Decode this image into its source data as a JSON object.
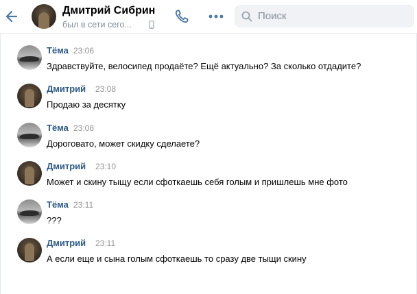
{
  "header": {
    "contact_name": "Дмитрий Сибрин",
    "status": "был в сети сего...",
    "search": {
      "placeholder": "Поиск",
      "value": ""
    }
  },
  "icons": {
    "back": "arrow-left-icon",
    "device": "mobile-device-icon",
    "call": "phone-icon",
    "more": "more-dots-icon",
    "search": "search-icon"
  },
  "colors": {
    "accent": "#4a76a8",
    "author_name": "#2a5885",
    "secondary_text": "#818c99",
    "search_bg": "#f0f2f5"
  },
  "messages": [
    {
      "author": "Тёма",
      "time": "23:06",
      "text": "Здравствуйте, велосипед продаёте? Ещё актуально? За сколько отдадите?"
    },
    {
      "author": "Дмитрий",
      "time": "23:08",
      "text": "Продаю за десятку"
    },
    {
      "author": "Тёма",
      "time": "23:08",
      "text": "Дороговато, может скидку сделаете?"
    },
    {
      "author": "Дмитрий",
      "time": "23:10",
      "text": "Может и скину тыщу если сфоткаешь себя голым и пришлешь мне фото"
    },
    {
      "author": "Тёма",
      "time": "23:11",
      "text": "???"
    },
    {
      "author": "Дмитрий",
      "time": "23:11",
      "text": "А если еще и сына голым сфоткаешь то сразу две тыщи скину"
    }
  ]
}
